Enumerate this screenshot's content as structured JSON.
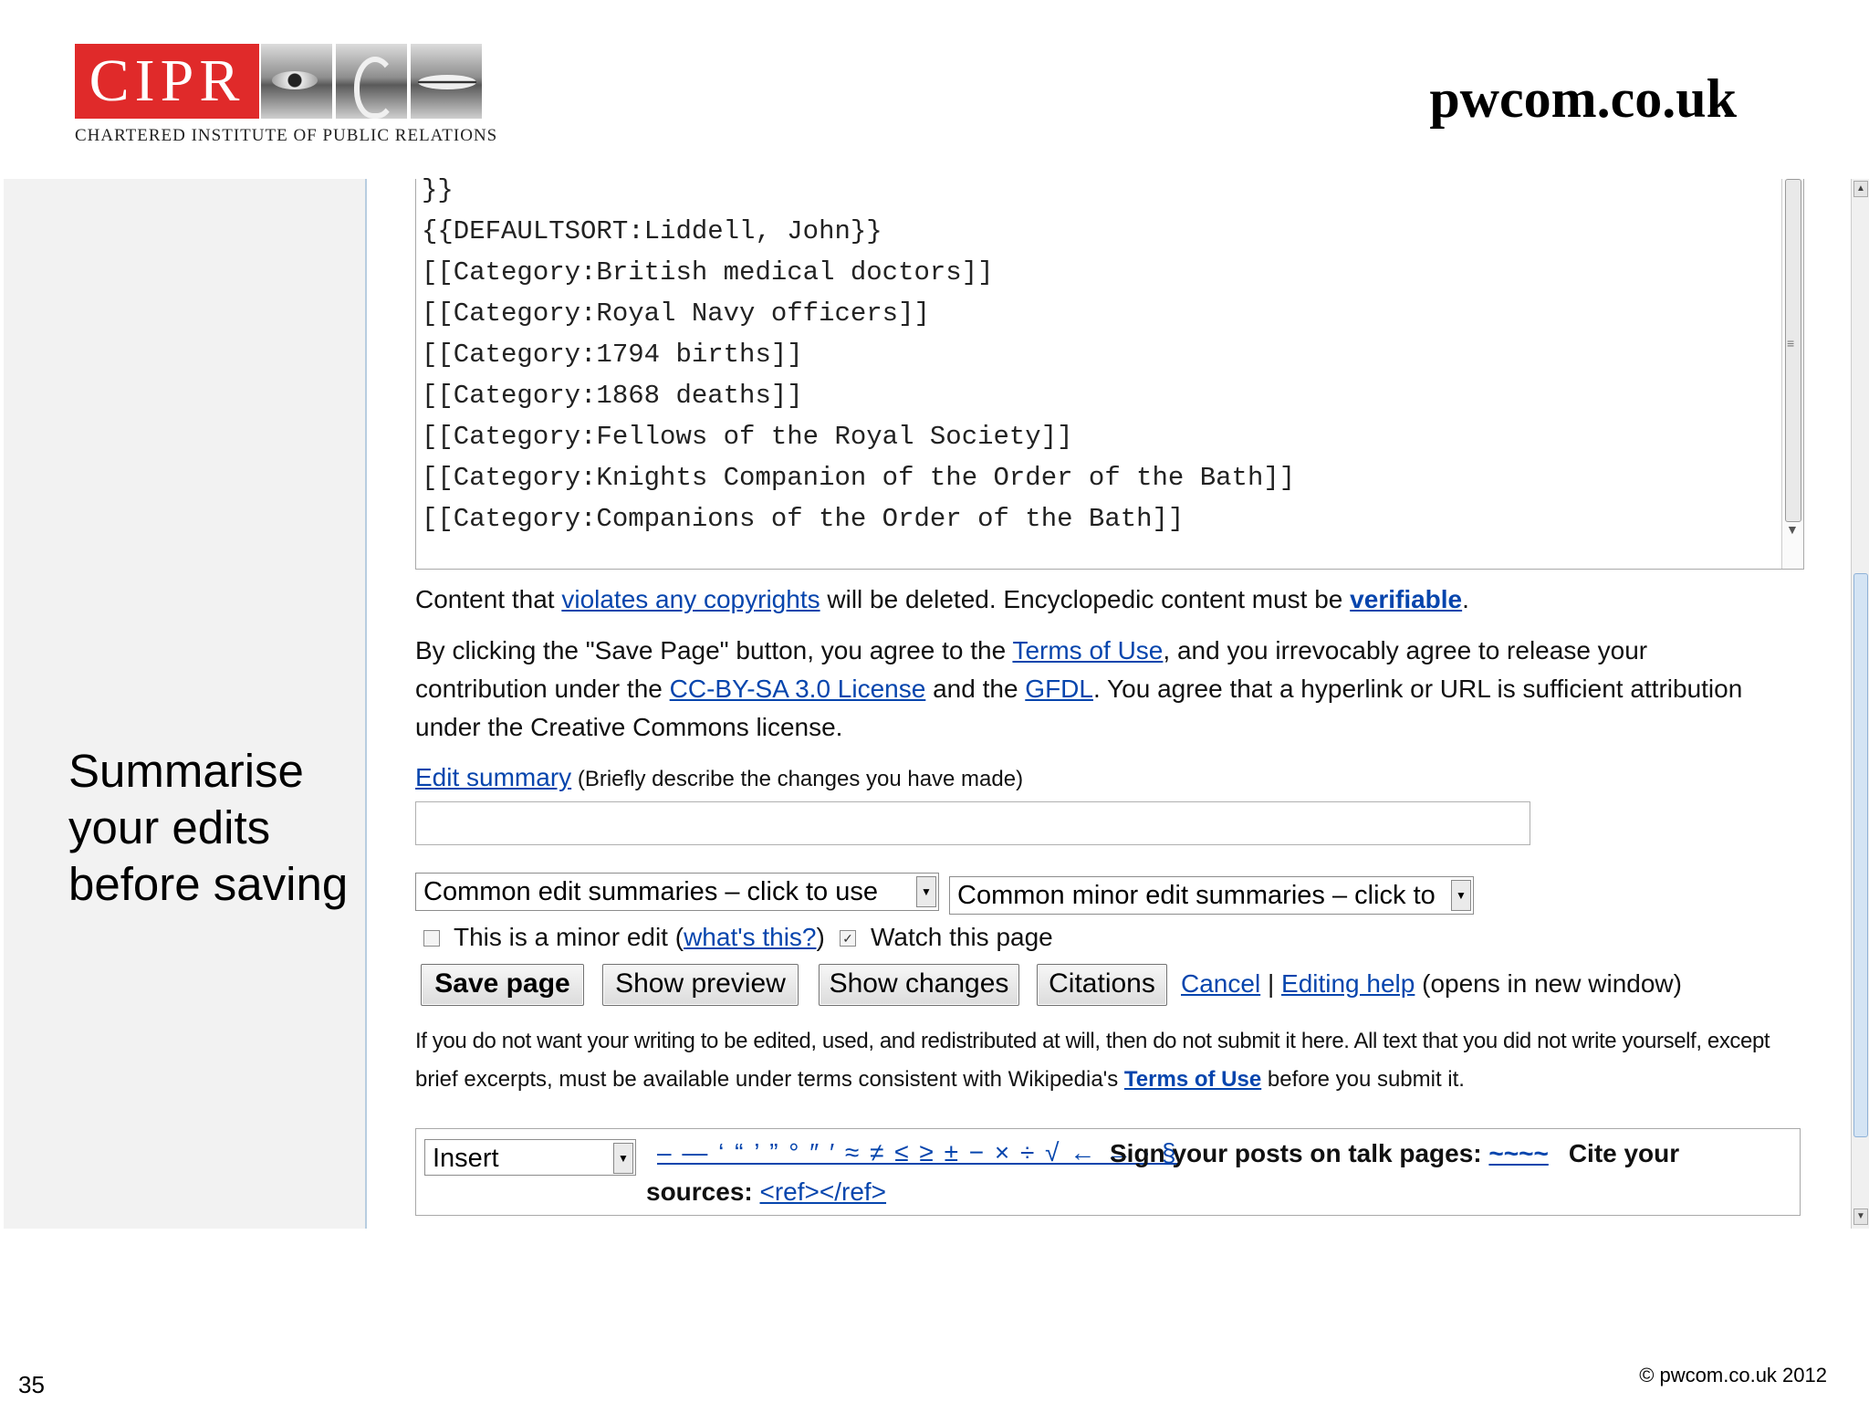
{
  "header": {
    "logo_text": "CIPR",
    "logo_subtitle": "CHARTERED INSTITUTE OF PUBLIC RELATIONS",
    "brand": "pwcom.co.uk"
  },
  "caption": "Summarise your edits before saving",
  "editor": {
    "lines": [
      "}}",
      "{{DEFAULTSORT:Liddell, John}}",
      "[[Category:British medical doctors]]",
      "[[Category:Royal Navy officers]]",
      "[[Category:1794 births]]",
      "[[Category:1868 deaths]]",
      "[[Category:Fellows of the Royal Society]]",
      "[[Category:Knights Companion of the Order of the Bath]]",
      "[[Category:Companions of the Order of the Bath]]"
    ]
  },
  "notice": {
    "p1_a": "Content that ",
    "p1_link": "violates any copyrights",
    "p1_b": " will be deleted. Encyclopedic content must be ",
    "p1_link2": "verifiable",
    "p1_c": ".",
    "p2_a": "By clicking the \"Save Page\" button, you agree to the ",
    "p2_link": "Terms of Use",
    "p2_b": ", and you irrevocably agree to release your",
    "p3_a": "contribution under the ",
    "p3_link": "CC-BY-SA 3.0 License",
    "p3_b": " and the ",
    "p3_link2": "GFDL",
    "p3_c": ". You agree that a hyperlink or URL is sufficient attribution",
    "p4": "under the Creative Commons license."
  },
  "summary": {
    "label_link": "Edit summary",
    "label_hint": " (Briefly describe the changes you have made)",
    "value": ""
  },
  "selects": {
    "common": "Common edit summaries – click to use",
    "minor": "Common minor edit summaries – click to"
  },
  "options": {
    "minor_a": "This is a minor edit (",
    "minor_link": "what's this?",
    "minor_b": ")",
    "minor_checked": false,
    "watch": "Watch this page",
    "watch_checked": true
  },
  "buttons": {
    "save": "Save page",
    "preview": "Show preview",
    "changes": "Show changes",
    "citations": "Citations"
  },
  "links": {
    "cancel": "Cancel",
    "sep": " | ",
    "help": "Editing help",
    "help_note": " (opens in new window)"
  },
  "disclaimer": {
    "l1": "If you do not want your writing to be edited, used, and redistributed at will, then do not submit it here. All text that you did not write yourself, except",
    "l2_a": "brief excerpts, must be available under terms consistent with Wikipedia's ",
    "l2_link": "Terms of Use",
    "l2_b": " before you submit it."
  },
  "charbar": {
    "select": "Insert",
    "chars": "– — ‘ “ ’ ” ° ″ ′ ≈ ≠ ≤ ≥ ± − × ÷ √ ← → · §",
    "sign_label": "Sign your posts on talk pages:",
    "sign_link": "~~~~",
    "cite_label": "Cite your",
    "cite_label2": "sources:",
    "cite_link": "<ref></ref>"
  },
  "footer": {
    "slide_number": "35",
    "copyright": "© pwcom.co.uk 2012"
  }
}
